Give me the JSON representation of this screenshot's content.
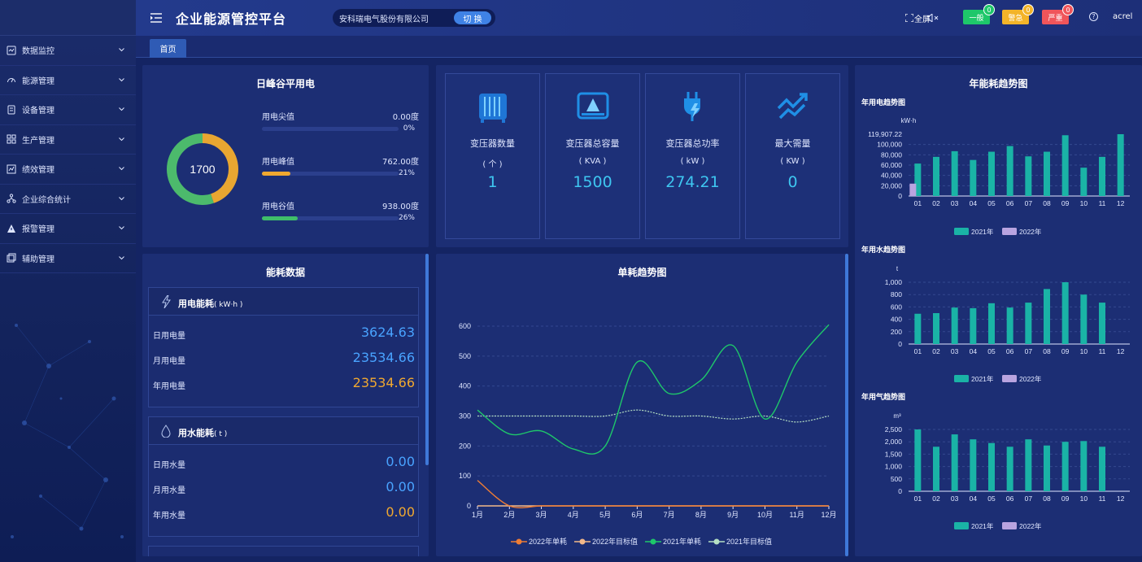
{
  "app": {
    "title": "企业能源管控平台",
    "company": "安科瑞电气股份有限公司",
    "switch_label": "切 换",
    "fullscreen_label": "全屏",
    "user": "acrel"
  },
  "alerts": [
    {
      "label": "一般",
      "count": "0",
      "color": "#1ec76a",
      "count_color": "#1ec76a"
    },
    {
      "label": "警急",
      "count": "0",
      "color": "#f3b429",
      "count_color": "#f3b429"
    },
    {
      "label": "严重",
      "count": "0",
      "color": "#f0555a",
      "count_color": "#f0555a"
    }
  ],
  "sidebar": {
    "items": [
      {
        "label": "数据监控",
        "icon": "monitor-icon"
      },
      {
        "label": "能源管理",
        "icon": "gauge-icon"
      },
      {
        "label": "设备管理",
        "icon": "device-icon"
      },
      {
        "label": "生产管理",
        "icon": "grid-icon"
      },
      {
        "label": "绩效管理",
        "icon": "chart-icon"
      },
      {
        "label": "企业综合统计",
        "icon": "hierarchy-icon"
      },
      {
        "label": "报警管理",
        "icon": "warning-icon"
      },
      {
        "label": "辅助管理",
        "icon": "assist-icon"
      }
    ]
  },
  "tabs": [
    {
      "label": "首页"
    }
  ],
  "peak_valley": {
    "title": "日峰谷平用电",
    "total": "1700",
    "rows": [
      {
        "label": "用电尖值",
        "value": "0.00度",
        "pct": "0%",
        "ratio": 0,
        "color": "#f0a830"
      },
      {
        "label": "用电峰值",
        "value": "762.00度",
        "pct": "21%",
        "ratio": 0.21,
        "color": "#f0a830"
      },
      {
        "label": "用电谷值",
        "value": "938.00度",
        "pct": "26%",
        "ratio": 0.26,
        "color": "#3fbe6a"
      }
    ],
    "donut": [
      {
        "value": 762,
        "color": "#e8a631"
      },
      {
        "value": 938,
        "color": "#4cba6c"
      }
    ]
  },
  "transformer_cards": [
    {
      "label": "变压器数量",
      "unit": "( 个 )",
      "value": "1",
      "icon": "transformer-icon"
    },
    {
      "label": "变压器总容量",
      "unit": "( KVA )",
      "value": "1500",
      "icon": "capacity-icon"
    },
    {
      "label": "变压器总功率",
      "unit": "( kW )",
      "value": "274.21",
      "icon": "plug-power-icon"
    },
    {
      "label": "最大需量",
      "unit": "( KW )",
      "value": "0",
      "icon": "trend-up-icon"
    }
  ],
  "energy_data": {
    "title": "能耗数据",
    "sections": [
      {
        "title": "用电能耗",
        "unit": "( kW·h )",
        "icon": "lightning-icon",
        "rows": [
          {
            "label": "日用电量",
            "value": "3624.63",
            "color": "#49a3ff"
          },
          {
            "label": "月用电量",
            "value": "23534.66",
            "color": "#49a3ff"
          },
          {
            "label": "年用电量",
            "value": "23534.66",
            "color": "#f0a830"
          }
        ]
      },
      {
        "title": "用水能耗",
        "unit": "( t )",
        "icon": "water-drop-icon",
        "rows": [
          {
            "label": "日用水量",
            "value": "0.00",
            "color": "#49a3ff"
          },
          {
            "label": "月用水量",
            "value": "0.00",
            "color": "#49a3ff"
          },
          {
            "label": "年用水量",
            "value": "0.00",
            "color": "#f0a830"
          }
        ]
      }
    ]
  },
  "trend_panel_title": "单耗趋势图",
  "year_panel_title": "年能耗趋势图",
  "chart_data": [
    {
      "type": "line",
      "title": "单耗趋势图",
      "categories": [
        "1月",
        "2月",
        "3月",
        "4月",
        "5月",
        "6月",
        "7月",
        "8月",
        "9月",
        "10月",
        "11月",
        "12月"
      ],
      "ylim": [
        0,
        600
      ],
      "yticks": [
        0,
        100,
        200,
        300,
        400,
        500,
        600
      ],
      "grid": true,
      "legend_position": "bottom",
      "series": [
        {
          "name": "2022年单耗",
          "color": "#ef7d35",
          "values": [
            85,
            0,
            0,
            0,
            0,
            0,
            0,
            0,
            0,
            0,
            0,
            0
          ]
        },
        {
          "name": "2022年目标值",
          "color": "#f2b88a",
          "values": [
            0,
            0,
            0,
            0,
            0,
            0,
            0,
            0,
            0,
            0,
            0,
            0
          ]
        },
        {
          "name": "2021年单耗",
          "color": "#1ec76a",
          "values": [
            320,
            240,
            250,
            190,
            200,
            480,
            375,
            420,
            535,
            290,
            480,
            605
          ]
        },
        {
          "name": "2021年目标值",
          "color": "#b5dfc3",
          "values": [
            300,
            300,
            300,
            300,
            300,
            320,
            300,
            300,
            290,
            300,
            280,
            300
          ]
        }
      ]
    },
    {
      "type": "bar",
      "title": "年用电趋势图",
      "ylabel": "kW·h",
      "max_label": "119,907.22",
      "categories": [
        "01",
        "02",
        "03",
        "04",
        "05",
        "06",
        "07",
        "08",
        "09",
        "10",
        "11",
        "12"
      ],
      "ylim": [
        0,
        120000
      ],
      "yticks": [
        0,
        20000,
        40000,
        60000,
        80000,
        100000
      ],
      "ytick_labels": [
        "0",
        "20,000",
        "40,000",
        "60,000",
        "80,000",
        "100,000"
      ],
      "legend_position": "bottom",
      "series": [
        {
          "name": "2021年",
          "color": "#1ab3a6",
          "values": [
            63000,
            76000,
            87000,
            70000,
            86000,
            97000,
            77000,
            86000,
            118000,
            55000,
            76000,
            120000
          ]
        },
        {
          "name": "2022年",
          "color": "#b9a4e0",
          "values": [
            24000,
            0,
            0,
            0,
            0,
            0,
            0,
            0,
            0,
            0,
            0,
            0
          ]
        }
      ]
    },
    {
      "type": "bar",
      "title": "年用水趋势图",
      "ylabel": "t",
      "categories": [
        "01",
        "02",
        "03",
        "04",
        "05",
        "06",
        "07",
        "08",
        "09",
        "10",
        "11",
        "12"
      ],
      "ylim": [
        0,
        1000
      ],
      "yticks": [
        0,
        200,
        400,
        600,
        800,
        1000
      ],
      "ytick_labels": [
        "0",
        "200",
        "400",
        "600",
        "800",
        "1,000"
      ],
      "legend_position": "bottom",
      "series": [
        {
          "name": "2021年",
          "color": "#1ab3a6",
          "values": [
            490,
            500,
            590,
            580,
            660,
            590,
            670,
            890,
            1000,
            800,
            670,
            0
          ]
        },
        {
          "name": "2022年",
          "color": "#b9a4e0",
          "values": [
            0,
            0,
            0,
            0,
            0,
            0,
            0,
            0,
            0,
            0,
            0,
            0
          ]
        }
      ]
    },
    {
      "type": "bar",
      "title": "年用气趋势图",
      "ylabel": "m³",
      "categories": [
        "01",
        "02",
        "03",
        "04",
        "05",
        "06",
        "07",
        "08",
        "09",
        "10",
        "11",
        "12"
      ],
      "ylim": [
        0,
        2500
      ],
      "yticks": [
        0,
        500,
        1000,
        1500,
        2000,
        2500
      ],
      "ytick_labels": [
        "0",
        "500",
        "1,000",
        "1,500",
        "2,000",
        "2,500"
      ],
      "legend_position": "bottom",
      "series": [
        {
          "name": "2021年",
          "color": "#1ab3a6",
          "values": [
            2500,
            1800,
            2300,
            2100,
            1950,
            1800,
            2100,
            1850,
            2000,
            2030,
            1800,
            0
          ]
        },
        {
          "name": "2022年",
          "color": "#b9a4e0",
          "values": [
            0,
            0,
            0,
            0,
            0,
            0,
            0,
            0,
            0,
            0,
            0,
            0
          ]
        }
      ]
    }
  ]
}
